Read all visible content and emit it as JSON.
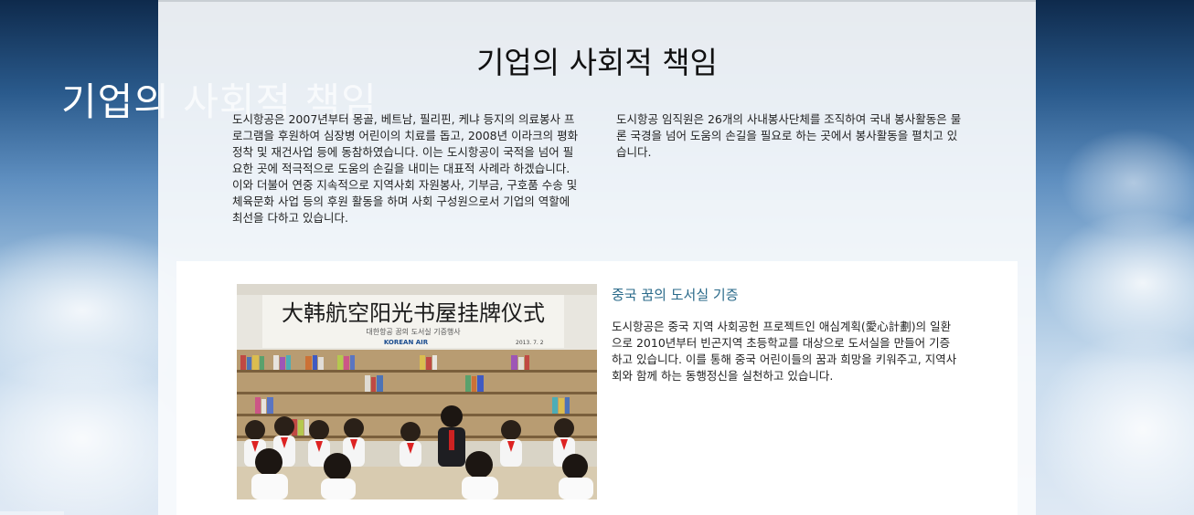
{
  "hero": {
    "title": "기업의 사회적 책임"
  },
  "section": {
    "title": "기업의 사회적 책임",
    "intro_left": "도시항공은 2007년부터 몽골, 베트남, 필리핀, 케냐 등지의 의료봉사 프로그램을 후원하여 심장병 어린이의 치료를 돕고, 2008년 이라크의 평화정착 및 재건사업 등에 동참하였습니다. 이는 도시항공이 국적을 넘어 필요한 곳에 적극적으로 도움의 손길을 내미는 대표적 사례라 하겠습니다. 이와 더불어 연중 지속적으로 지역사회 자원봉사, 기부금, 구호품 수송 및 체육문화 사업 등의 후원 활동을 하며 사회 구성원으로서 기업의 역할에 최선을 다하고 있습니다.",
    "intro_right": "도시항공 임직원은 26개의 사내봉사단체를 조직하여 국내 봉사활동은 물론 국경을 넘어 도움의 손길을 필요로 하는 곳에서 봉사활동을 펼치고 있습니다."
  },
  "card": {
    "heading": "중국 꿈의 도서실 기증",
    "body": "도시항공은 중국 지역 사회공헌 프로젝트인 애심계획(愛心計劃)의 일환으로 2010년부터 빈곤지역 초등학교를 대상으로 도서실을 만들어 기증하고 있습니다. 이를 통해 중국 어린이들의 꿈과 희망을 키워주고, 지역사회와 함께 하는 동행정신을 실천하고 있습니다.",
    "photo": {
      "banner_text": "大韩航空阳光书屋挂牌仪式",
      "banner_subtext": "대한항공 꿈의 도서실 기증행사",
      "banner_logo": "KOREAN AIR",
      "banner_date": "2013. 7. 2"
    }
  },
  "colors": {
    "heading_accent": "#2a6a8a",
    "panel_bg": "#f8fafc"
  }
}
